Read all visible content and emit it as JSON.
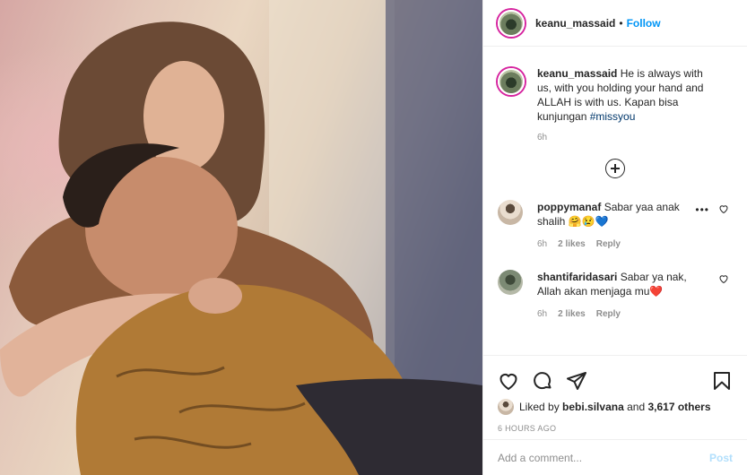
{
  "post": {
    "author": "keanu_massaid",
    "follow_label": "Follow",
    "separator": "•",
    "caption": "He is always with us, with you holding your hand and ALLAH is with us. Kapan bisa kunjungan ",
    "caption_hashtag": "#missyou",
    "caption_time": "6h"
  },
  "comments": [
    {
      "username": "poppymanaf",
      "text": "Sabar yaa anak shalih 🤗😢💙",
      "time": "6h",
      "likes": "2 likes",
      "reply": "Reply",
      "more": "•••"
    },
    {
      "username": "shantifaridasari",
      "text": "Sabar ya nak, Allah akan menjaga mu❤️",
      "time": "6h",
      "likes": "2 likes",
      "reply": "Reply"
    }
  ],
  "likes_line": {
    "prefix": "Liked by ",
    "user": "bebi.silvana",
    "middle": " and ",
    "count": "3,617 others"
  },
  "timestamp": "6 HOURS AGO",
  "add_comment": {
    "placeholder": "Add a comment...",
    "post_label": "Post"
  },
  "icons": {
    "like": "heart-icon",
    "comment": "comment-icon",
    "share": "share-icon",
    "save": "bookmark-icon",
    "load_more": "plus-circle-icon"
  },
  "colors": {
    "follow_blue": "#0095f6",
    "post_disabled": "#b2dffc",
    "muted": "#8e8e8e",
    "hashtag": "#00376b"
  }
}
